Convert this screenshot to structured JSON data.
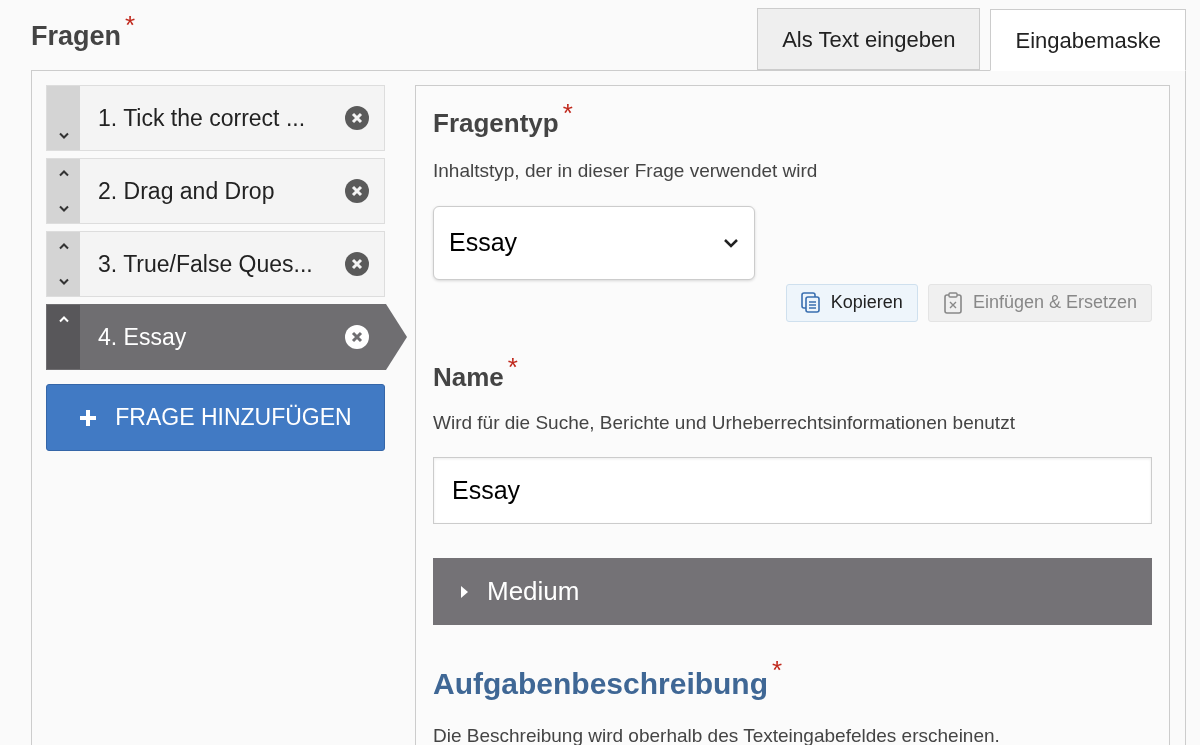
{
  "heading": {
    "label": "Fragen",
    "required_mark": "*"
  },
  "tabs": [
    {
      "label": "Als Text eingeben",
      "selected": false
    },
    {
      "label": "Eingabemaske",
      "selected": true
    }
  ],
  "questions": [
    {
      "label": "1. Tick the correct ...",
      "selected": false,
      "can_move_up": false,
      "can_move_down": true
    },
    {
      "label": "2. Drag and Drop",
      "selected": false,
      "can_move_up": true,
      "can_move_down": true
    },
    {
      "label": "3. True/False Ques...",
      "selected": false,
      "can_move_up": true,
      "can_move_down": true
    },
    {
      "label": "4. Essay",
      "selected": true,
      "can_move_up": true,
      "can_move_down": false
    }
  ],
  "add_button": {
    "label": "FRAGE HINZUFÜGEN"
  },
  "question_type": {
    "label": "Fragentyp",
    "required_mark": "*",
    "description": "Inhaltstyp, der in dieser Frage verwendet wird",
    "value": "Essay"
  },
  "copy_buttons": [
    {
      "label": "Kopieren",
      "disabled": false
    },
    {
      "label": "Einfügen & Ersetzen",
      "disabled": true
    }
  ],
  "name": {
    "label": "Name",
    "required_mark": "*",
    "description": "Wird für die Suche, Berichte und Urheberrechtsinformationen benutzt",
    "value": "Essay"
  },
  "medium": {
    "label": "Medium",
    "expanded": false
  },
  "task": {
    "label": "Aufgabenbeschreibung",
    "required_mark": "*",
    "description": "Die Beschreibung wird oberhalb des Texteingabefeldes erscheinen."
  }
}
